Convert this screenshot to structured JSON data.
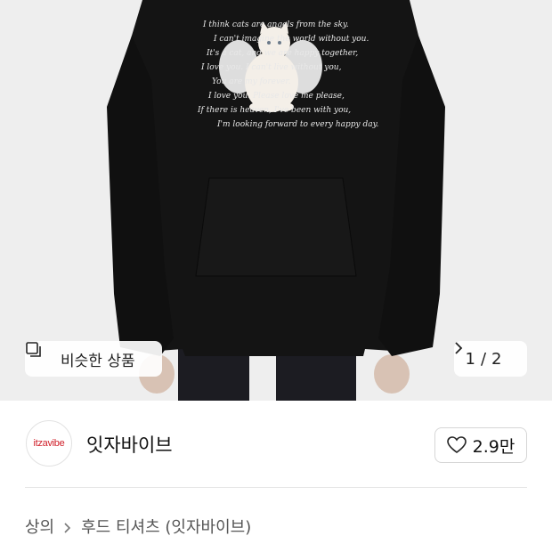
{
  "product_image": {
    "print_lines": [
      "I think cats are angels from the sky.",
      "I can't imagine the world without you.",
      "It's a cat, and we are happy together,",
      "I love you. I can't live without you,",
      "You are my forever.",
      "I love you. Please love me please,",
      "If there is heaven, I've been with you,",
      "I'm looking forward to every happy day."
    ],
    "colors": {
      "background": "#eeeeee",
      "hoodie": "#141414",
      "print_text": "#e8e8e8",
      "cat": "#f4efe8"
    }
  },
  "similar_button": {
    "icon": "similar-items-icon",
    "label": "비슷한 상품"
  },
  "pager": {
    "current": "1",
    "separator": "/",
    "total": "2",
    "icon": "chevron-right-icon"
  },
  "brand": {
    "logo_text": "itzavibe",
    "name": "잇자바이브",
    "logo_color": "#d0202a"
  },
  "like": {
    "icon": "heart-icon",
    "count": "2.9만"
  },
  "breadcrumb": {
    "items": [
      "상의",
      "후드 티셔츠 (잇자바이브)"
    ],
    "separator_icon": "chevron-right-icon"
  }
}
